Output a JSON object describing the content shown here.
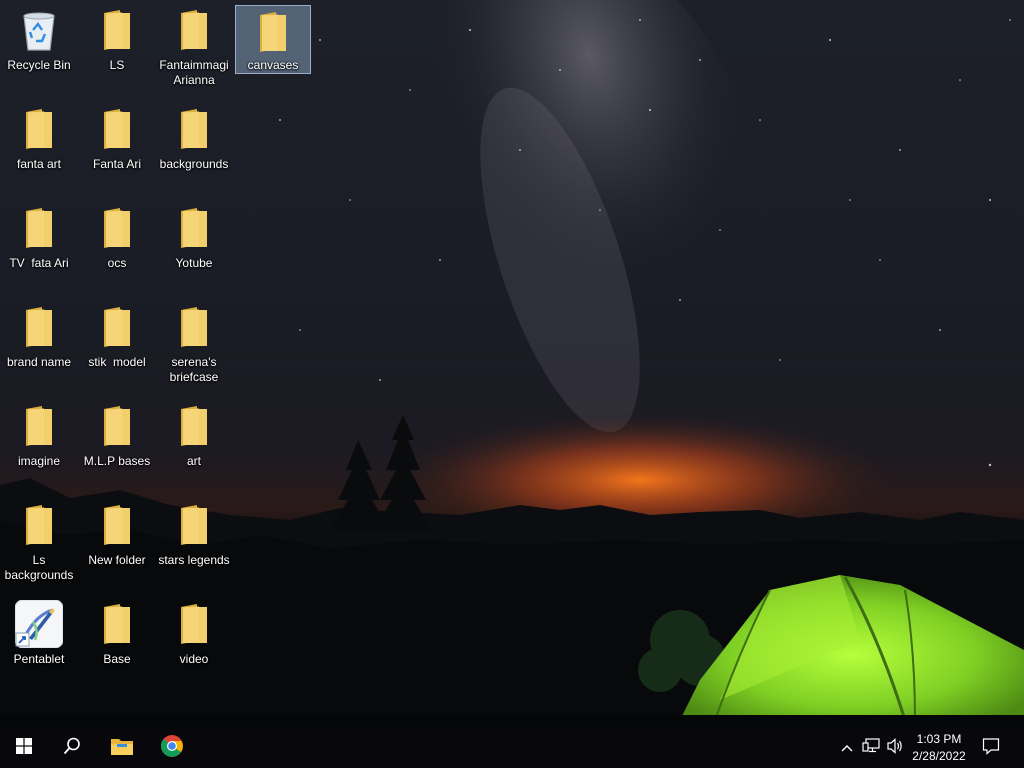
{
  "desktop": {
    "icons": [
      {
        "id": "recycle-bin",
        "label": "Recycle Bin",
        "type": "recycle"
      },
      {
        "id": "ls",
        "label": "LS",
        "type": "folder"
      },
      {
        "id": "fantaimmagi-arianna",
        "label": "Fantaimmagi Arianna",
        "type": "folder"
      },
      {
        "id": "canvases",
        "label": "canvases",
        "type": "folder",
        "selected": true
      },
      {
        "id": "fanta-art",
        "label": "fanta art",
        "type": "folder"
      },
      {
        "id": "fanta-ari",
        "label": "Fanta Ari",
        "type": "folder"
      },
      {
        "id": "backgrounds",
        "label": "backgrounds",
        "type": "folder"
      },
      {
        "id": "tv-fata-ari",
        "label": "TV  fata Ari",
        "type": "folder"
      },
      {
        "id": "ocs",
        "label": "ocs",
        "type": "folder"
      },
      {
        "id": "yotube",
        "label": "Yotube",
        "type": "folder"
      },
      {
        "id": "brand-name",
        "label": "brand name",
        "type": "folder"
      },
      {
        "id": "stik-model",
        "label": "stik  model",
        "type": "folder"
      },
      {
        "id": "serenas-briefcase",
        "label": "serena's briefcase",
        "type": "folder"
      },
      {
        "id": "imagine",
        "label": "imagine",
        "type": "folder"
      },
      {
        "id": "mlp-bases",
        "label": "M.L.P bases",
        "type": "folder"
      },
      {
        "id": "art",
        "label": "art",
        "type": "folder"
      },
      {
        "id": "ls-backgrounds",
        "label": "Ls backgrounds",
        "type": "folder"
      },
      {
        "id": "new-folder",
        "label": "New folder",
        "type": "folder"
      },
      {
        "id": "stars-legends",
        "label": "stars legends",
        "type": "folder"
      },
      {
        "id": "pentablet",
        "label": "Pentablet",
        "type": "app"
      },
      {
        "id": "base",
        "label": "Base",
        "type": "folder"
      },
      {
        "id": "video",
        "label": "video",
        "type": "folder"
      }
    ]
  },
  "taskbar": {
    "start_icon": "windows-logo-icon",
    "search_icon": "search-icon",
    "pinned": [
      {
        "name": "file-explorer",
        "icon": "folder-icon"
      },
      {
        "name": "chrome",
        "icon": "chrome-icon"
      }
    ],
    "tray": {
      "icons": [
        "chevron-up-icon",
        "network-icon",
        "volume-icon"
      ],
      "time": "1:03 PM",
      "date": "2/28/2022",
      "notification_icon": "notification-icon"
    }
  },
  "colors": {
    "folder": "#f3cf6b",
    "folder_dark": "#dcae3e",
    "tent": "#8edb2a",
    "selection": "#a0bee1",
    "horizon_glow": "#ff7a1c"
  }
}
